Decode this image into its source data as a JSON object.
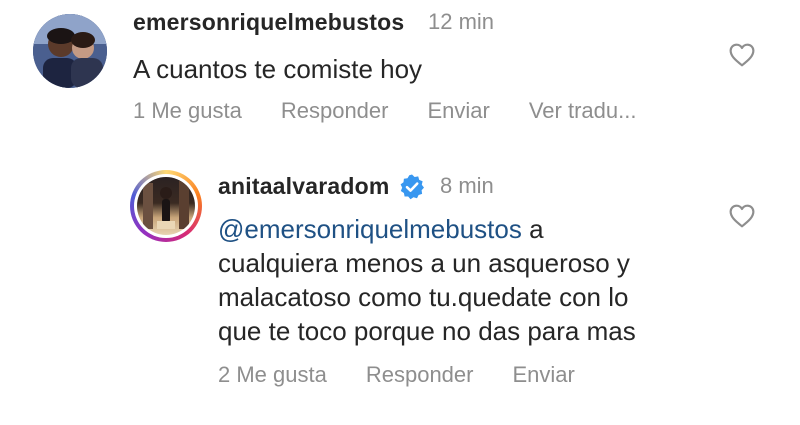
{
  "comments": [
    {
      "username": "emersonriquelmebustos",
      "time": "12 min",
      "text": "A cuantos te comiste hoy",
      "actions": {
        "likes": "1 Me gusta",
        "reply": "Responder",
        "send": "Enviar",
        "translate": "Ver tradu..."
      }
    },
    {
      "username": "anitaalvaradom",
      "time": "8 min",
      "mention": "@emersonriquelmebustos",
      "lines": [
        " a",
        "cualquiera menos a un asqueroso y",
        "malacatoso como tu.quedate con lo",
        "que te toco porque no das para mas"
      ],
      "actions": {
        "likes": "2 Me gusta",
        "reply": "Responder",
        "send": "Enviar"
      }
    }
  ],
  "icons": {
    "like": "heart-outline-icon",
    "verified": "verified-badge-icon"
  },
  "colors": {
    "mention": "#1f5184",
    "verified": "#3897f0",
    "meta": "#8e8e8e",
    "text": "#262626"
  }
}
